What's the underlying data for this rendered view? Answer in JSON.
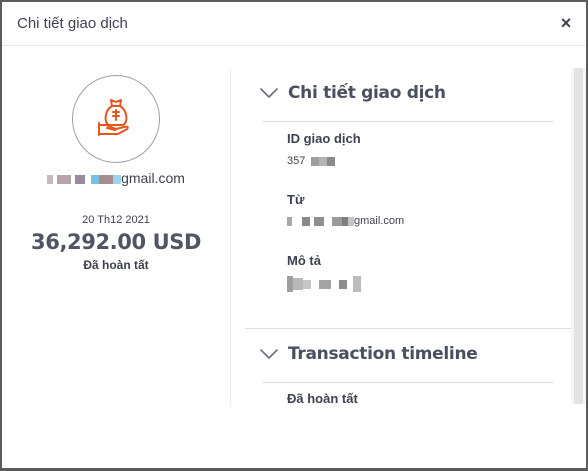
{
  "modal": {
    "title": "Chi tiết giao dịch",
    "close_symbol": "×"
  },
  "summary": {
    "avatar_icon": "money-bag-hand-icon",
    "email_suffix": "gmail.com",
    "date": "20 Th12 2021",
    "amount": "36,292.00 USD",
    "status": "Đã hoàn tất",
    "accent_color": "#e8541e"
  },
  "details": {
    "section_title": "Chi tiết giao dịch",
    "fields": [
      {
        "label": "ID giao dịch",
        "value": "357"
      },
      {
        "label": "Từ",
        "value": "gmail.com"
      },
      {
        "label": "Mô tả",
        "value": ""
      }
    ]
  },
  "timeline": {
    "section_title": "Transaction timeline",
    "first_item": "Đã hoàn tất"
  }
}
